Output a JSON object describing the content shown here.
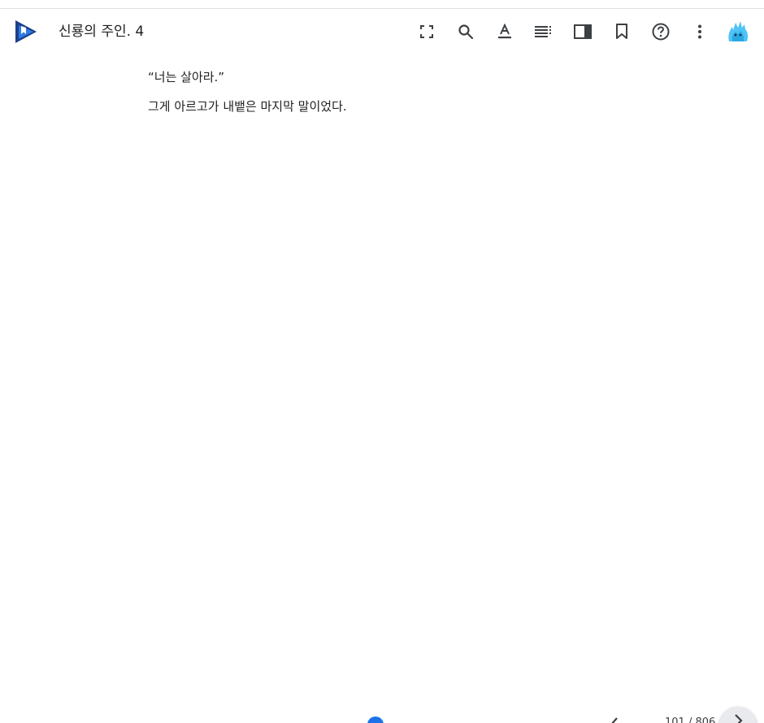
{
  "header": {
    "title": "신룡의 주인. 4",
    "icons": [
      "fullscreen-icon",
      "search-icon",
      "text-format-icon",
      "table-of-contents-icon",
      "layout-panel-icon",
      "bookmark-icon",
      "help-icon",
      "more-vert-icon"
    ]
  },
  "content": {
    "paragraphs": [
      "“너는 살아라.”",
      "그게 아르고가 내뱉은 마지막 말이었다."
    ]
  },
  "footer": {
    "page_indicator": "101 / 806",
    "progress": 0.48
  },
  "colors": {
    "accent": "#1a73e8",
    "logo_dark": "#1e3f8a",
    "logo_light": "#2d7be5",
    "icon": "#3c4043",
    "avatar": "#4fc3f7"
  }
}
